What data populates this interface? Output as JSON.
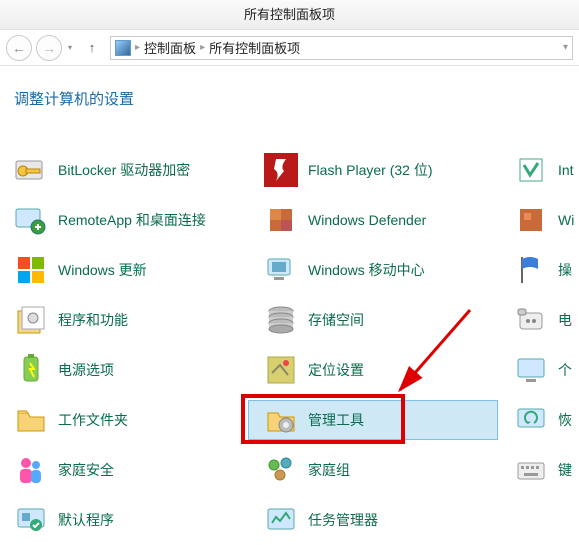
{
  "window": {
    "title": "所有控制面板项"
  },
  "nav": {
    "back_glyph": "←",
    "forward_glyph": "→",
    "up_glyph": "↑",
    "dropdown_glyph": "▾"
  },
  "breadcrumb": {
    "root": "控制面板",
    "current": "所有控制面板项",
    "sep": "▸"
  },
  "heading": "调整计算机的设置",
  "items": {
    "col1": [
      "BitLocker 驱动器加密",
      "RemoteApp 和桌面连接",
      "Windows 更新",
      "程序和功能",
      "电源选项",
      "工作文件夹",
      "家庭安全",
      "默认程序"
    ],
    "col2": [
      "Flash Player (32 位)",
      "Windows Defender",
      "Windows 移动中心",
      "存储空间",
      "定位设置",
      "管理工具",
      "家庭组",
      "任务管理器"
    ],
    "col3": [
      "Int",
      "Wi",
      "操",
      "电",
      "个",
      "恢",
      "键",
      ""
    ]
  },
  "icons": {
    "col1": [
      "bitlocker",
      "remoteapp",
      "windows-update",
      "programs",
      "power",
      "work-folders",
      "family-safety",
      "default-programs"
    ],
    "col2": [
      "flash",
      "defender",
      "mobility",
      "storage",
      "location",
      "admin-tools",
      "homegroup",
      "task-manager"
    ],
    "col3": [
      "internet",
      "wifi",
      "action-center",
      "phone",
      "personal",
      "recovery",
      "keyboard",
      "blank"
    ]
  }
}
